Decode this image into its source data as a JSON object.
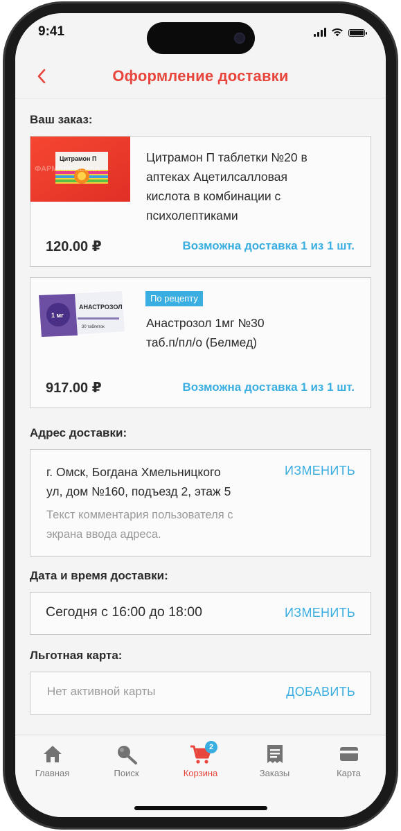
{
  "status": {
    "time": "9:41"
  },
  "header": {
    "title": "Оформление доставки"
  },
  "order": {
    "section_title": "Ваш заказ:",
    "items": [
      {
        "name_lines": [
          "Цитрамон П таблетки №20 в",
          "аптеках Ацетилсалловая",
          "кислота в комбинации с",
          "психолептиками"
        ],
        "price": "120.00 ₽",
        "availability": "Возможна доставка 1 из 1 шт.",
        "image_text": "Цитрамон П",
        "image_watermark": "ФАРМАКОПЕЙКА"
      },
      {
        "badge": "По рецепту",
        "name_lines": [
          "Анастрозол 1мг №30",
          "таб.п/пл/о (Белмед)"
        ],
        "price": "917.00 ₽",
        "availability": "Возможна доставка 1 из 1 шт.",
        "image_text": "АНАСТРОЗОЛ",
        "image_dose": "1 мг",
        "image_count": "30 таблеток"
      }
    ]
  },
  "address": {
    "section_title": "Адрес доставки:",
    "lines": [
      "г. Омск, Богдана Хмельницкого",
      "ул, дом №160, подъезд 2, этаж 5"
    ],
    "comment_lines": [
      "Текст комментария пользователя с",
      "экрана ввода адреса."
    ],
    "action": "ИЗМЕНИТЬ"
  },
  "delivery_time": {
    "section_title": "Дата и время доставки:",
    "value": "Сегодня с 16:00 до 18:00",
    "action": "ИЗМЕНИТЬ"
  },
  "discount_card": {
    "section_title": "Льготная карта:",
    "value": "Нет активной карты",
    "action": "ДОБАВИТЬ"
  },
  "tabbar": {
    "items": [
      {
        "label": "Главная",
        "icon": "home-icon"
      },
      {
        "label": "Поиск",
        "icon": "search-icon"
      },
      {
        "label": "Корзина",
        "icon": "cart-icon",
        "badge": "2",
        "active": true
      },
      {
        "label": "Заказы",
        "icon": "receipt-icon"
      },
      {
        "label": "Карта",
        "icon": "card-icon"
      }
    ]
  },
  "colors": {
    "accent": "#e8453c",
    "link": "#3aaee0",
    "text": "#2b2b2b",
    "muted": "#9a9a9a"
  }
}
